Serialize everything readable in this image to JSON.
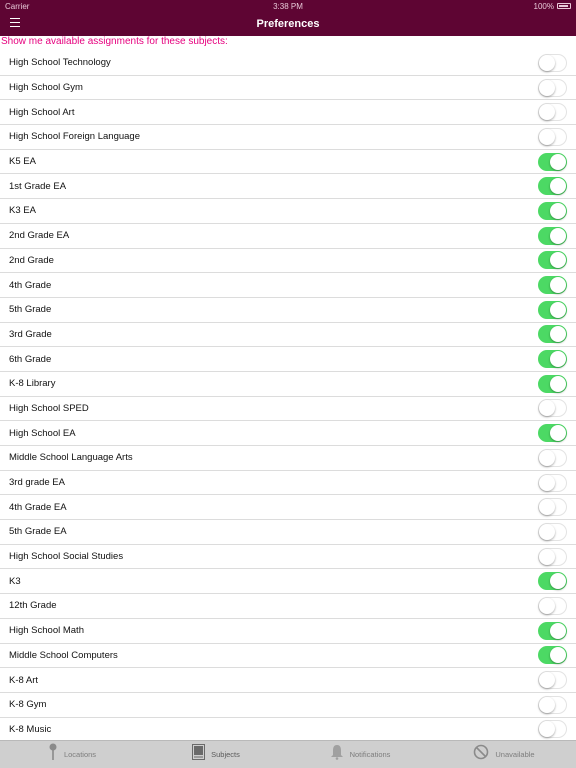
{
  "status": {
    "carrier": "Carrier",
    "time": "3:38 PM",
    "battery": "100%"
  },
  "navbar": {
    "title": "Preferences"
  },
  "section_header": "Show me available assignments for these subjects:",
  "colors": {
    "brand": "#5e0533",
    "accent": "#e6007e",
    "toggle_on": "#4cd964"
  },
  "subjects": [
    {
      "label": "High School Technology",
      "on": false
    },
    {
      "label": "High School Gym",
      "on": false
    },
    {
      "label": "High School Art",
      "on": false
    },
    {
      "label": "High School Foreign Language",
      "on": false
    },
    {
      "label": "K5 EA",
      "on": true
    },
    {
      "label": "1st Grade EA",
      "on": true
    },
    {
      "label": "K3 EA",
      "on": true
    },
    {
      "label": "2nd Grade EA",
      "on": true
    },
    {
      "label": "2nd Grade",
      "on": true
    },
    {
      "label": "4th Grade",
      "on": true
    },
    {
      "label": "5th Grade",
      "on": true
    },
    {
      "label": "3rd Grade",
      "on": true
    },
    {
      "label": "6th Grade",
      "on": true
    },
    {
      "label": "K-8 Library",
      "on": true
    },
    {
      "label": "High School SPED",
      "on": false
    },
    {
      "label": "High School EA",
      "on": true
    },
    {
      "label": "Middle School Language Arts",
      "on": false
    },
    {
      "label": "3rd grade EA",
      "on": false
    },
    {
      "label": "4th Grade EA",
      "on": false
    },
    {
      "label": "5th Grade EA",
      "on": false
    },
    {
      "label": "High School Social Studies",
      "on": false
    },
    {
      "label": "K3",
      "on": true
    },
    {
      "label": "12th Grade",
      "on": false
    },
    {
      "label": "High School Math",
      "on": true
    },
    {
      "label": "Middle School Computers",
      "on": true
    },
    {
      "label": "K-8 Art",
      "on": false
    },
    {
      "label": "K-8 Gym",
      "on": false
    },
    {
      "label": "K-8 Music",
      "on": false
    }
  ],
  "tabbar": {
    "tabs": [
      {
        "label": "Locations",
        "icon": "location-pin-icon"
      },
      {
        "label": "Subjects",
        "icon": "book-icon"
      },
      {
        "label": "Notifications",
        "icon": "bell-icon"
      },
      {
        "label": "Unavailable",
        "icon": "prohibited-icon"
      }
    ],
    "active": "Subjects"
  }
}
